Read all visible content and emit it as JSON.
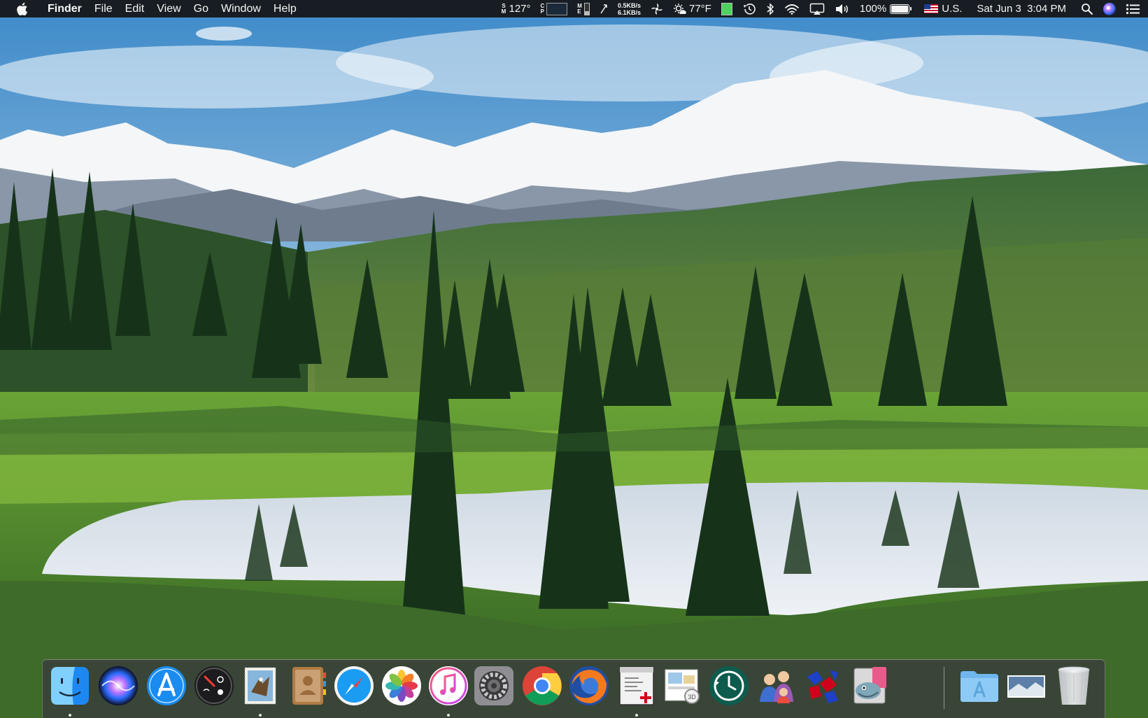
{
  "menubar": {
    "apple": "apple-icon",
    "app_name": "Finder",
    "menus": [
      "File",
      "Edit",
      "View",
      "Go",
      "Window",
      "Help"
    ],
    "status": {
      "temperature_cpu": "127°",
      "net_up": "0.5KB/s",
      "net_down": "6.1KB/s",
      "weather_temp": "77°F",
      "battery_percent": "100%",
      "input_source": "U.S.",
      "clock": "Sat Jun 3  3:04 PM"
    }
  },
  "dock": {
    "apps": [
      {
        "name": "Finder",
        "icon": "finder-icon",
        "running": true
      },
      {
        "name": "Siri",
        "icon": "siri-icon",
        "running": false
      },
      {
        "name": "App Store",
        "icon": "app-store-icon",
        "running": false
      },
      {
        "name": "Dashboard",
        "icon": "dashboard-icon",
        "running": false
      },
      {
        "name": "Mail",
        "icon": "mail-icon",
        "running": true
      },
      {
        "name": "Contacts",
        "icon": "contacts-icon",
        "running": false
      },
      {
        "name": "Safari",
        "icon": "safari-icon",
        "running": false
      },
      {
        "name": "Photos",
        "icon": "photos-icon",
        "running": false
      },
      {
        "name": "iTunes",
        "icon": "itunes-icon",
        "running": true
      },
      {
        "name": "System Preferences",
        "icon": "system-preferences-icon",
        "running": false
      },
      {
        "name": "Google Chrome",
        "icon": "chrome-icon",
        "running": false
      },
      {
        "name": "Firefox",
        "icon": "firefox-icon",
        "running": false
      },
      {
        "name": "Script Editor",
        "icon": "script-editor-icon",
        "running": true
      },
      {
        "name": "Preview",
        "icon": "preview-icon",
        "running": false
      },
      {
        "name": "Time Machine",
        "icon": "time-machine-icon",
        "running": false
      },
      {
        "name": "Users",
        "icon": "users-icon",
        "running": false
      },
      {
        "name": "Puzzle",
        "icon": "puzzle-icon",
        "running": false
      },
      {
        "name": "SequelPro",
        "icon": "sequel-pro-icon",
        "running": false
      }
    ],
    "stacks": [
      {
        "name": "Applications",
        "icon": "applications-folder-icon"
      },
      {
        "name": "Downloads",
        "icon": "downloads-stack-icon"
      },
      {
        "name": "Trash",
        "icon": "trash-icon"
      }
    ]
  },
  "colors": {
    "menubar_bg": "#141414",
    "dock_bg": "#37373c",
    "sky": "#6f9fcb",
    "forest": "#2f5a2a"
  }
}
